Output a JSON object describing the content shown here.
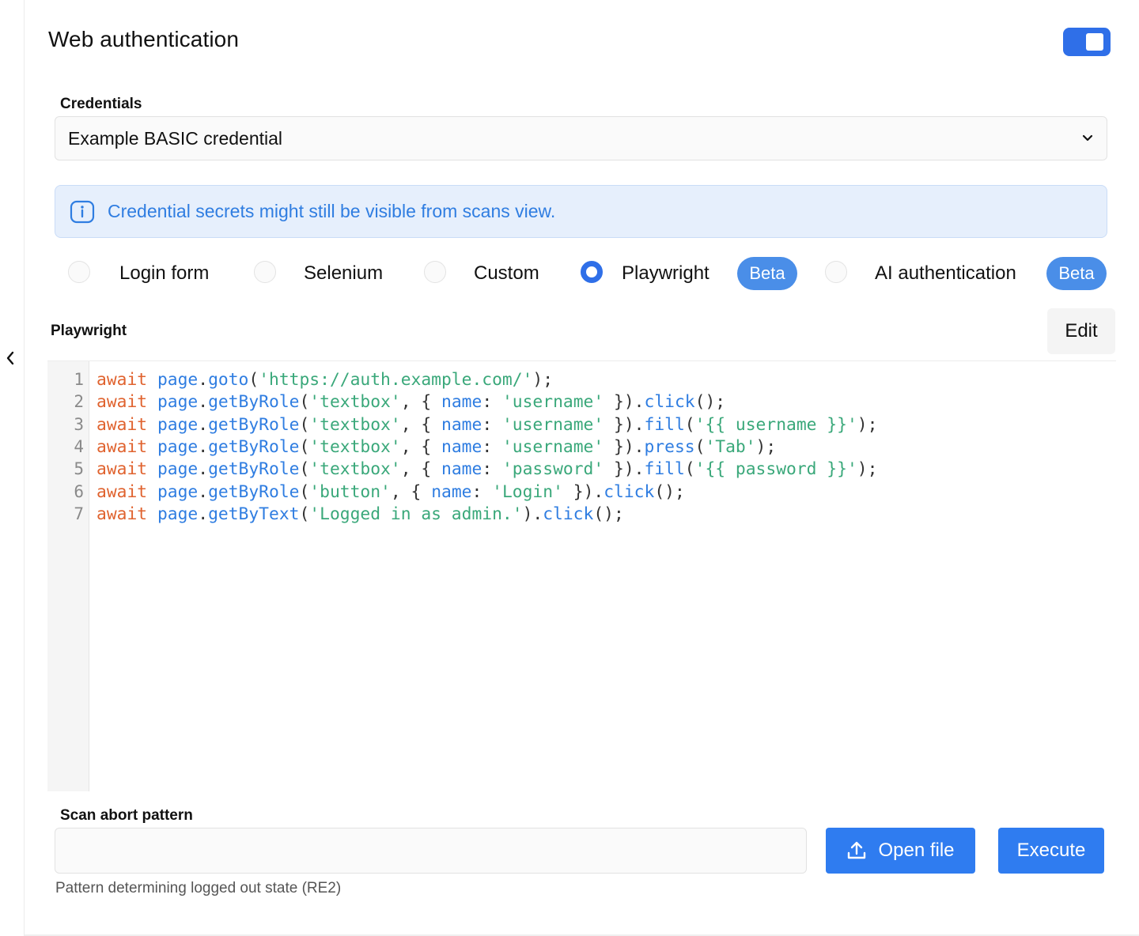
{
  "section": {
    "title": "Web authentication",
    "toggle_on": true,
    "accent_color": "#2f6fe8"
  },
  "credentials": {
    "label": "Credentials",
    "selected": "Example BASIC credential"
  },
  "info_banner": {
    "icon": "info-icon",
    "message": "Credential secrets might still be visible from scans view."
  },
  "auth_methods": [
    {
      "label": "Login form",
      "selected": false
    },
    {
      "label": "Selenium",
      "selected": false
    },
    {
      "label": "Custom",
      "selected": false
    },
    {
      "label": "Playwright",
      "selected": true,
      "badge": "Beta"
    },
    {
      "label": "AI authentication",
      "selected": false,
      "badge": "Beta"
    }
  ],
  "editor": {
    "label": "Playwright",
    "edit_label": "Edit",
    "line_numbers": [
      "1",
      "2",
      "3",
      "4",
      "5",
      "6",
      "7"
    ],
    "lines": [
      "await page.goto('https://auth.example.com/');",
      "await page.getByRole('textbox', { name: 'username' }).click();",
      "await page.getByRole('textbox', { name: 'username' }).fill('{{ username }}');",
      "await page.getByRole('textbox', { name: 'username' }).press('Tab');",
      "await page.getByRole('textbox', { name: 'password' }).fill('{{ password }}');",
      "await page.getByRole('button', { name: 'Login' }).click();",
      "await page.getByText('Logged in as admin.').click();"
    ]
  },
  "scan_abort": {
    "label": "Scan abort pattern",
    "value": "",
    "hint": "Pattern determining logged out state (RE2)"
  },
  "actions": {
    "open_file": "Open file",
    "execute": "Execute"
  }
}
